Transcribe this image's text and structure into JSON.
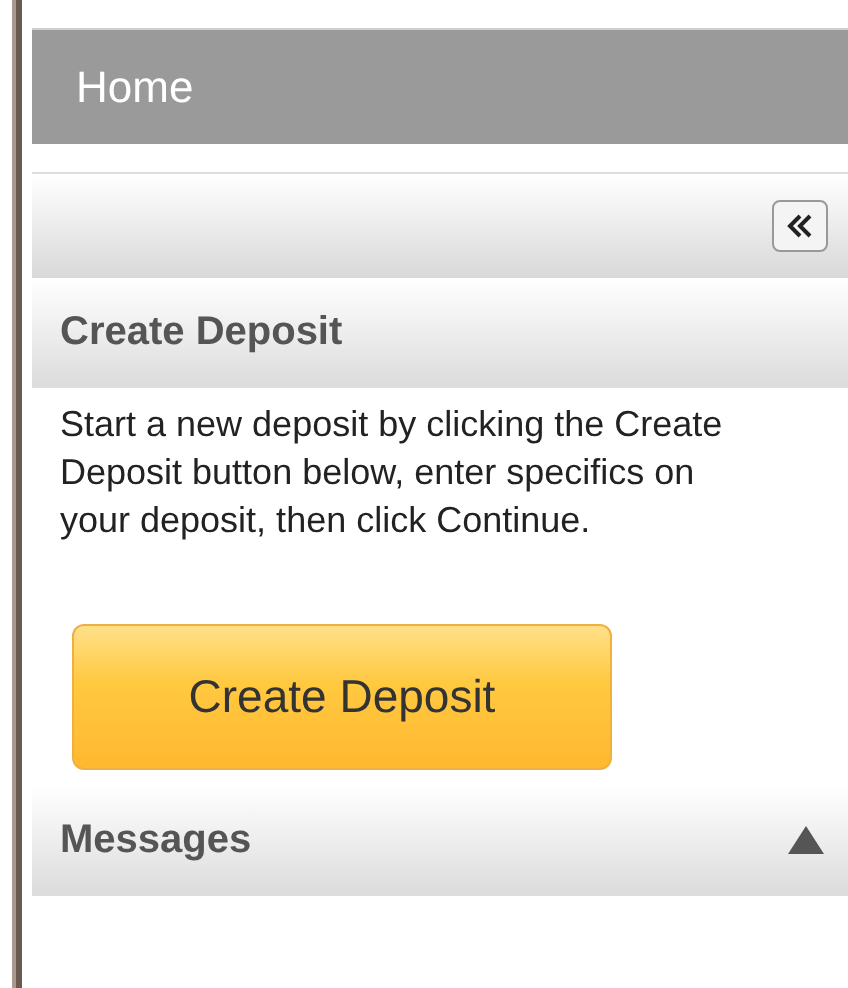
{
  "header": {
    "title": "Home"
  },
  "toolbar": {
    "collapse_button": true
  },
  "sections": [
    {
      "title": "Create Deposit",
      "expanded": true,
      "text": "Start a new deposit by clicking the Create Deposit button below, enter specifics on your deposit, then click Continue.",
      "button": "Create Deposit"
    },
    {
      "title": "Messages",
      "expanded": false
    }
  ]
}
